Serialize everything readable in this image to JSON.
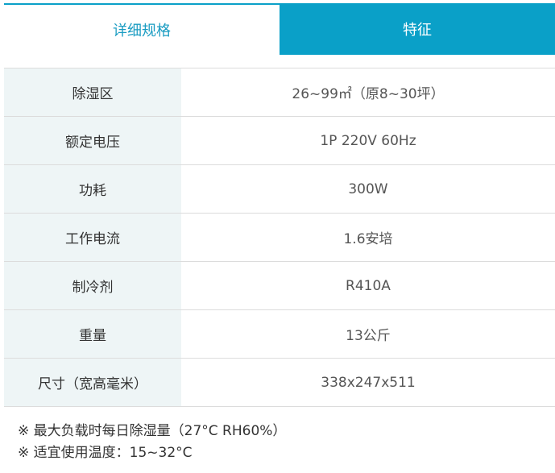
{
  "tabs": [
    {
      "label": "详细规格",
      "active": false
    },
    {
      "label": "特征",
      "active": true
    }
  ],
  "specs": [
    {
      "label": "除湿区",
      "value": "26~99㎡（原8~30坪）"
    },
    {
      "label": "额定电压",
      "value": "1P 220V 60Hz"
    },
    {
      "label": "功耗",
      "value": "300W"
    },
    {
      "label": "工作电流",
      "value": "1.6安培"
    },
    {
      "label": "制冷剂",
      "value": "R410A"
    },
    {
      "label": "重量",
      "value": "13公斤"
    },
    {
      "label": "尺寸（宽高毫米）",
      "value": "338x247x511"
    }
  ],
  "notes": [
    "※ 最大负载时每日除湿量（27°C RH60%）",
    "※ 适宜使用温度：15~32°C"
  ],
  "colors": {
    "accent": "#0aa0c8",
    "label_bg": "#eef5f6",
    "border": "#dcdcdc"
  }
}
